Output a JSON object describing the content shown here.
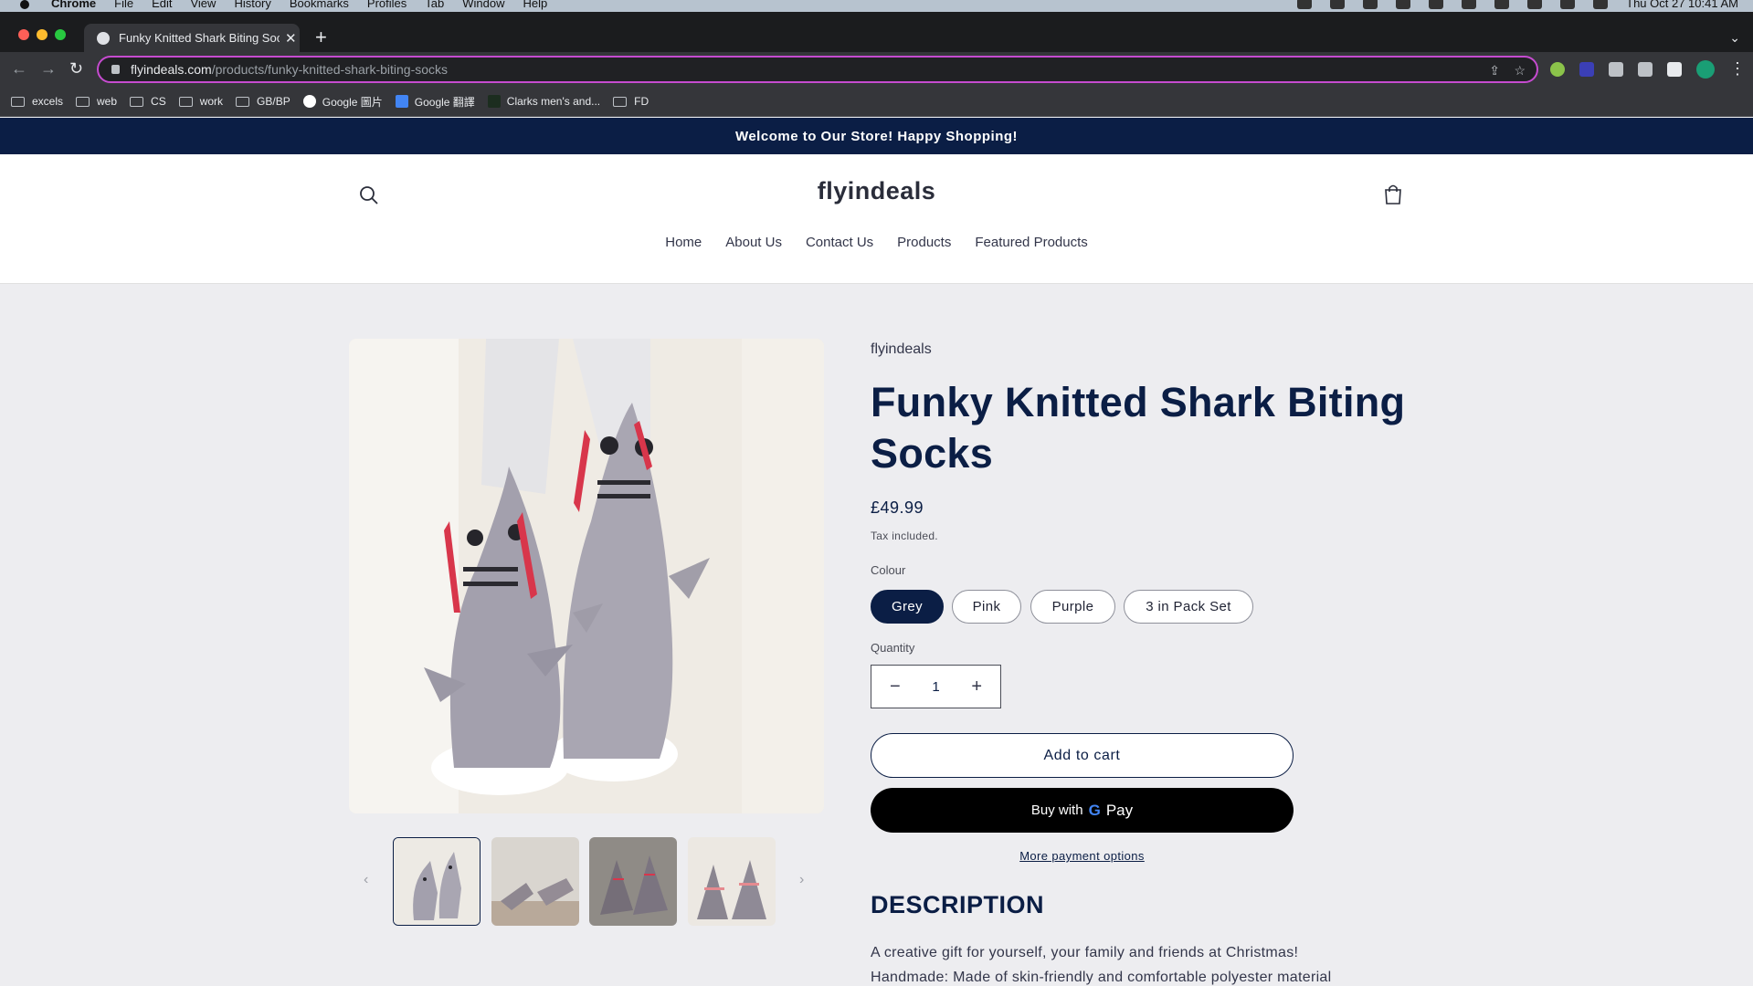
{
  "menubar": {
    "app": "Chrome",
    "items": [
      "File",
      "Edit",
      "View",
      "History",
      "Bookmarks",
      "Profiles",
      "Tab",
      "Window",
      "Help"
    ],
    "clock": "Thu Oct 27  10:41 AM"
  },
  "browser": {
    "tab_title": "Funky Knitted Shark Biting Soc",
    "url_host": "flyindeals.com",
    "url_path": "/products/funky-knitted-shark-biting-socks",
    "bookmarks": [
      {
        "label": "excels",
        "icon": "folder-icon"
      },
      {
        "label": "web",
        "icon": "folder-icon"
      },
      {
        "label": "CS",
        "icon": "folder-icon"
      },
      {
        "label": "work",
        "icon": "folder-icon"
      },
      {
        "label": "GB/BP",
        "icon": "folder-icon"
      },
      {
        "label": "Google 圖片",
        "icon": "google-icon"
      },
      {
        "label": "Google 翻譯",
        "icon": "translate-icon"
      },
      {
        "label": "Clarks men's and...",
        "icon": "clarks-icon"
      },
      {
        "label": "FD",
        "icon": "folder-icon"
      }
    ]
  },
  "store": {
    "announcement": "Welcome to Our Store! Happy Shopping!",
    "logo": "flyindeals",
    "nav": [
      "Home",
      "About Us",
      "Contact Us",
      "Products",
      "Featured Products"
    ]
  },
  "product": {
    "vendor": "flyindeals",
    "title": "Funky Knitted Shark Biting Socks",
    "price": "£49.99",
    "tax_note": "Tax included.",
    "colour_label": "Colour",
    "colours": [
      "Grey",
      "Pink",
      "Purple",
      "3 in Pack Set"
    ],
    "selected_colour": "Grey",
    "quantity_label": "Quantity",
    "quantity": "1",
    "add_to_cart": "Add to cart",
    "buy_with": "Buy with",
    "buy_brand_g": "G",
    "buy_brand_pay": "Pay",
    "more_payment": "More payment options",
    "description_heading": "DESCRIPTION",
    "description_lines": [
      "A creative gift for yourself, your family and friends at Christmas!",
      "Handmade: Made of skin-friendly and comfortable polyester material"
    ]
  },
  "colors": {
    "accent_navy": "#0b1e45",
    "omnibox_border": "#c64bd0"
  }
}
